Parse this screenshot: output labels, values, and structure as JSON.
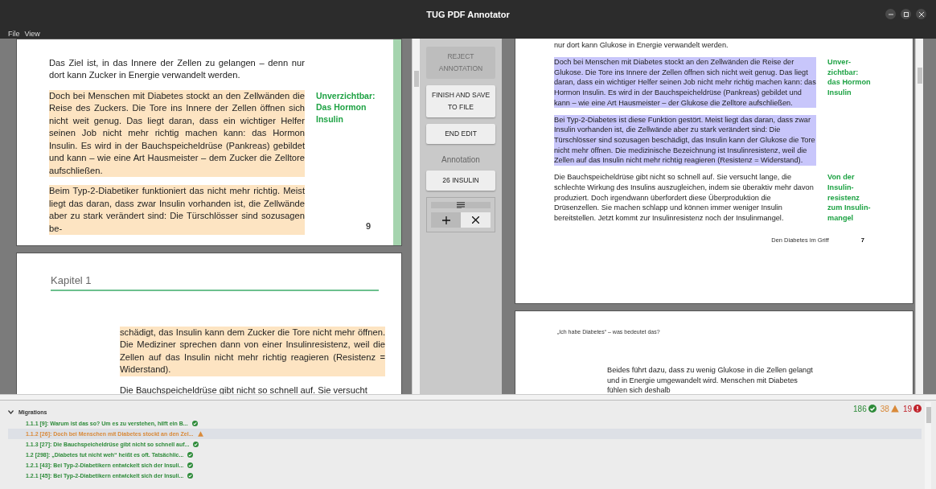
{
  "window": {
    "title": "TUG PDF Annotator"
  },
  "menu": [
    "File",
    "View"
  ],
  "left_document": {
    "pages": [
      {
        "paragraphs": [
          {
            "text": "Das Ziel ist, in das Innere der Zellen zu gelangen – denn nur dort kann Zucker in Energie verwandelt werden.",
            "highlighted": false
          },
          {
            "text": "Doch bei Menschen mit Diabetes stockt an den Zellwänden die Reise des Zuckers. Die Tore ins Innere der Zellen öffnen sich nicht weit genug. Das liegt daran, dass ein wichtiger Helfer seinen Job nicht mehr richtig machen kann: das Hormon Insulin. Es wird in der Bauchspeicheldrüse (Pankreas) gebildet und kann – wie eine Art Hausmeister – dem Zucker die Zelltore aufschließen.",
            "highlighted": true,
            "note": [
              "Unverzichtbar:",
              "Das Hormon",
              "Insulin"
            ]
          },
          {
            "text": "Beim Typ-2-Diabetiker funktioniert das nicht mehr richtig. Meist liegt das daran, dass zwar Insulin vorhanden ist, die Zellwände aber zu stark verändert sind: Die Türschlösser sind sozusagen be-",
            "highlighted": true
          }
        ],
        "page_number": "9"
      },
      {
        "chapter": "Kapitel 1",
        "paragraphs": [
          {
            "text": "schädigt, das Insulin kann dem Zucker die Tore nicht mehr öffnen. Die Mediziner sprechen dann von einer Insulinresistenz, weil die Zellen auf das Insulin nicht mehr richtig reagieren (Resistenz = Widerstand).",
            "highlighted": true
          },
          {
            "text": "Die Bauchspeicheldrüse gibt nicht so schnell auf. Sie versucht",
            "highlighted": false
          }
        ]
      }
    ]
  },
  "controls": {
    "buttons": [
      {
        "label": "REJECT ANNOTATION",
        "disabled": true
      },
      {
        "label": "FINISH AND SAVE TO FILE",
        "disabled": false
      },
      {
        "label": "END EDIT",
        "disabled": false
      }
    ],
    "annotation_label": "Annotation",
    "annotation_value": "26 INSULIN",
    "tools": [
      {
        "kind": "add",
        "selected": true
      },
      {
        "kind": "remove",
        "selected": false
      }
    ]
  },
  "right_document": {
    "pages": [
      {
        "paragraphs": [
          {
            "text": "nur dort kann Glukose in Energie verwandelt werden.",
            "highlighted": false
          },
          {
            "text": "Doch bei Menschen mit Diabetes stockt an den Zellwänden die Reise der Glukose. Die Tore ins Innere der Zellen öffnen sich nicht weit genug. Das liegt daran, dass ein wichtiger Helfer seinen Job nicht mehr richtig machen kann: das Hormon Insulin. Es wird in der Bauchspeicheldrüse (Pankreas) gebildet und kann – wie eine Art Hausmeister – der Glukose die Zelltore aufschließen.",
            "highlighted": true,
            "note": [
              "Unver-",
              "zichtbar:",
              "das Hormon",
              "Insulin"
            ]
          },
          {
            "text": "Bei Typ-2-Diabetes ist diese Funktion gestört. Meist liegt das daran, dass zwar Insulin vorhanden ist, die Zellwände aber zu stark verändert sind: Die Türschlösser sind sozusagen beschädigt, das Insulin kann der Glukose die Tore nicht mehr öffnen. Die medizinische Bezeichnung ist Insulinresistenz, weil die Zellen auf das Insulin nicht mehr richtig reagieren (Resistenz = Widerstand).",
            "highlighted": true
          },
          {
            "text": "Die Bauchspeicheldrüse gibt nicht so schnell auf. Sie versucht lange, die schlechte Wirkung des Insulins auszugleichen, indem sie überaktiv mehr davon produziert. Doch irgendwann überfordert diese Überproduktion die Drüsenzellen. Sie machen schlapp und können immer weniger Insulin bereitstellen. Jetzt kommt zur Insulinresistenz noch der Insulinmangel.",
            "highlighted": false,
            "note": [
              "Von der",
              "Insulin-",
              "resistenz",
              "zum Insulin-",
              "mangel"
            ]
          }
        ],
        "footer": "Den Diabetes im Griff",
        "page_number": "7"
      },
      {
        "header": "„Ich habe Diabetes“ – was bedeutet das?",
        "paragraphs": [
          {
            "text": "Beides führt dazu, dass zu wenig Glukose in die Zellen gelangt und in Energie umgewandelt wird. Menschen mit Diabetes fühlen sich deshalb",
            "highlighted": false
          }
        ]
      }
    ]
  },
  "migrations": {
    "title": "Migrations",
    "expanded": true,
    "counts": {
      "ok": "186",
      "warning": "38",
      "error": "19"
    },
    "items": [
      {
        "text": "1.1.1 [9]: Warum ist das so? Um es zu verstehen, hilft ein B...",
        "kind": "ok",
        "selected": false
      },
      {
        "text": "1.1.2 [26]: Doch bei Menschen mit Diabetes stockt an den Zel...",
        "kind": "warning",
        "selected": true
      },
      {
        "text": "1.1.3 [27]: Die Bauchspeicheldrüse gibt nicht so schnell auf...",
        "kind": "ok",
        "selected": false
      },
      {
        "text": "1.2 [298]: „Diabetes tut nicht weh“ heißt es oft. Tatsächlic...",
        "kind": "ok",
        "selected": false
      },
      {
        "text": "1.2.1 [43]: Bei Typ-2-Diabetikern entwickelt sich der Insuli...",
        "kind": "ok",
        "selected": false
      },
      {
        "text": "1.2.1 [45]: Bei Typ-2-Diabetikern entwickelt sich der Insuli...",
        "kind": "ok",
        "selected": false
      }
    ]
  }
}
